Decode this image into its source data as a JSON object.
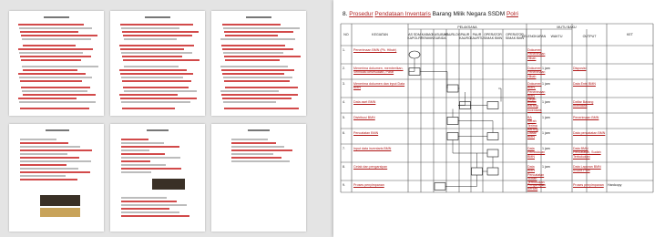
{
  "doc": {
    "section_num": "8.",
    "title_pre": "Prosedur",
    "title_red": "Pendataan Inventaris",
    "title_mid": "Barang Milik Negara SSDM",
    "title_end": "Polri"
  },
  "headers": {
    "no": "NO",
    "kegiatan": "KEGIATAN",
    "pelaksana": "PELAKSANA",
    "mutu_baku": "MUTU BAKU",
    "ket": "KET",
    "as": "AS SDM\nKAPOLRI",
    "karo": "KABAG\nRENMIN",
    "kasubag": "KASUBAG\nSUBIDA",
    "paur": "PAURLOG",
    "paur2": "PAUR\nKAURO",
    "paur3": "PAUR\nKAURTU",
    "operator": "OPERATOR\nSIMAK BMN",
    "kelengkapan": "KELENGKAPAN",
    "waktu": "WAKTU",
    "output": "OUTPUT"
  },
  "rows": [
    {
      "no": "1.",
      "kegiatan": "Penerimaan BMN (Pk. Hibah)",
      "kelengkapan": "Dokumen Penerimaan Hibah",
      "waktu": "",
      "output": ""
    },
    {
      "no": "2.",
      "kegiatan": "Menerima dokumen, memberikan, Verifikasi kesesuaian, Paraf",
      "kelengkapan": "Dokumen Penerimaan Hibah",
      "waktu": "1 jam",
      "output": "Disposisi"
    },
    {
      "no": "3.",
      "kegiatan": "Menerima dokumen dan input Data BMN",
      "kelengkapan": "Dokumen BMN, Penerimaan BMN Hibah",
      "waktu": "1 jam",
      "output": "Data Entri BMN"
    },
    {
      "no": "4.",
      "kegiatan": "Data aset BMN",
      "kelengkapan": "Daftar Barang Inventaris",
      "waktu": "1 jam",
      "output": "Daftar Barang Inventaris"
    },
    {
      "no": "5.",
      "kegiatan": "Distribusi BMN",
      "kelengkapan": "BA Serah Terima Barang",
      "waktu": "1 jam",
      "output": "Penerimaan BMN"
    },
    {
      "no": "6.",
      "kegiatan": "Pencatatan BMN",
      "kelengkapan": "Daftar BMN",
      "waktu": "1 jam",
      "output": "Data pencatatan BMN"
    },
    {
      "no": "7.",
      "kegiatan": "Input data inventaris BMN",
      "kelengkapan": "Data Pembukuan BMN",
      "waktu": "1 jam",
      "output": "Data BMN Pencatatan, Sudah Terbukukan"
    },
    {
      "no": "8.",
      "kegiatan": "Cetak dan pengarsipan",
      "kelengkapan": "Data BMN Pencatatan Sudah Terbukukan",
      "waktu": "1 jam",
      "output": "Data Laporan BMN SSDM Polri"
    },
    {
      "no": "9.",
      "kegiatan": "Proses penyimpanan",
      "kelengkapan": "Pengarsipan Berkas",
      "waktu": "-",
      "output": "Proses penyimpanan",
      "ket": "Hardcopy"
    }
  ],
  "thumbnails": [
    "page-1",
    "page-2",
    "page-3",
    "page-4",
    "page-5",
    "page-6"
  ]
}
